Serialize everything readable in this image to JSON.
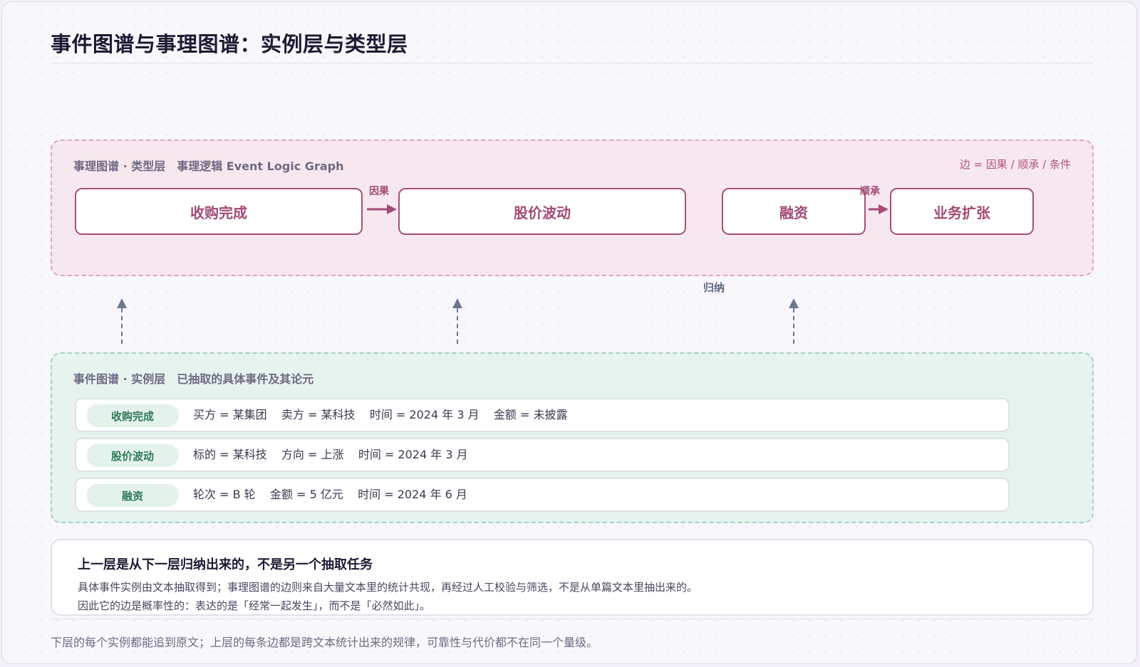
{
  "title": "事件图谱与事理图谱：实例层与类型层",
  "type_layer": {
    "header": "事理图谱 · 类型层",
    "subheader": "事理逻辑 Event Logic Graph",
    "edge_legend": "边 = 因果 / 顺承 / 条件",
    "nodes": [
      "收购完成",
      "股价波动",
      "融资",
      "业务扩张"
    ],
    "edges": [
      {
        "from": "收购完成",
        "to": "股价波动",
        "label": "因果"
      },
      {
        "from": "融资",
        "to": "业务扩张",
        "label": "顺承"
      }
    ]
  },
  "induction_label": "归纳",
  "instance_layer": {
    "header": "事件图谱 · 实例层",
    "subheader": "已抽取的具体事件及其论元",
    "rows": [
      {
        "tag": "收购完成",
        "args": "买方 = 某集团    卖方 = 某科技    时间 = 2024 年 3 月    金额 = 未披露"
      },
      {
        "tag": "股价波动",
        "args": "标的 = 某科技    方向 = 上涨    时间 = 2024 年 3 月"
      },
      {
        "tag": "融资",
        "args": "轮次 = B 轮    金额 = 5 亿元    时间 = 2024 年 6 月"
      }
    ]
  },
  "note": {
    "heading": "上一层是从下一层归纳出来的，不是另一个抽取任务",
    "line1": "具体事件实例由文本抽取得到；事理图谱的边则来自大量文本里的统计共现，再经过人工校验与筛选，不是从单篇文本里抽出来的。",
    "line2": "因此它的边是概率性的：表达的是「经常一起发生」，而不是「必然如此」。"
  },
  "footer": "下层的每个实例都能追到原文；上层的每条边都是跨文本统计出来的规律，可靠性与代价都不在同一个量级。",
  "colors": {
    "type_accent": "#a34b74",
    "instance_accent": "#2f7a56",
    "arrow_gray": "#6b7891"
  }
}
